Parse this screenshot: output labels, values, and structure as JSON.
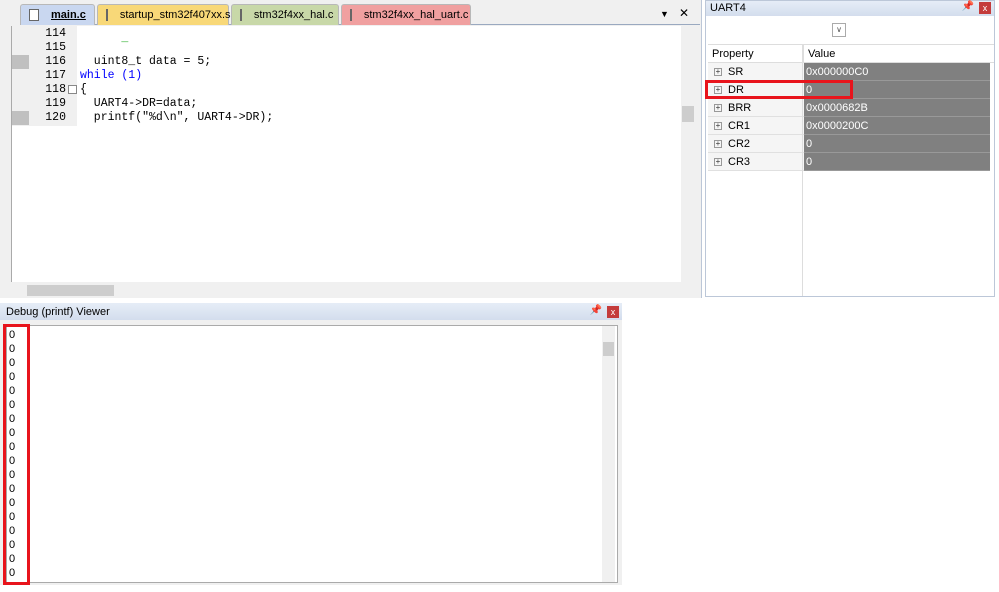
{
  "editor": {
    "tabs": [
      {
        "label": "main.c",
        "color": "#c9d7f0"
      },
      {
        "label": "startup_stm32f407xx.s",
        "color": "#f8d878"
      },
      {
        "label": "stm32f4xx_hal.c",
        "color": "#c8d8a8"
      },
      {
        "label": "stm32f4xx_hal_uart.c",
        "color": "#f0a0a0"
      }
    ],
    "tab_menu_icon": "▼",
    "tab_close_icon": "✕",
    "lines": [
      {
        "n": "114",
        "code": "      _"
      },
      {
        "n": "115",
        "code": ""
      },
      {
        "n": "116",
        "code": "  uint8_t data = 5;"
      },
      {
        "n": "117",
        "code": "while (1)"
      },
      {
        "n": "118",
        "code": "{"
      },
      {
        "n": "119",
        "code": "  UART4->DR=data;"
      },
      {
        "n": "120",
        "code": "  printf(\"%d\\n\", UART4->DR);"
      }
    ]
  },
  "props": {
    "title": "UART4",
    "col_property": "Property",
    "col_value": "Value",
    "rows": [
      {
        "name": "SR",
        "value": "0x000000C0"
      },
      {
        "name": "DR",
        "value": "0"
      },
      {
        "name": "BRR",
        "value": "0x0000682B"
      },
      {
        "name": "CR1",
        "value": "0x0000200C"
      },
      {
        "name": "CR2",
        "value": "0"
      },
      {
        "name": "CR3",
        "value": "0"
      }
    ]
  },
  "debug": {
    "title": "Debug (printf) Viewer",
    "output": [
      "0",
      "0",
      "0",
      "0",
      "0",
      "0",
      "0",
      "0",
      "0",
      "0",
      "0",
      "0",
      "0",
      "0",
      "0",
      "0",
      "0",
      "0"
    ]
  },
  "highlight_color": "#e8141c"
}
